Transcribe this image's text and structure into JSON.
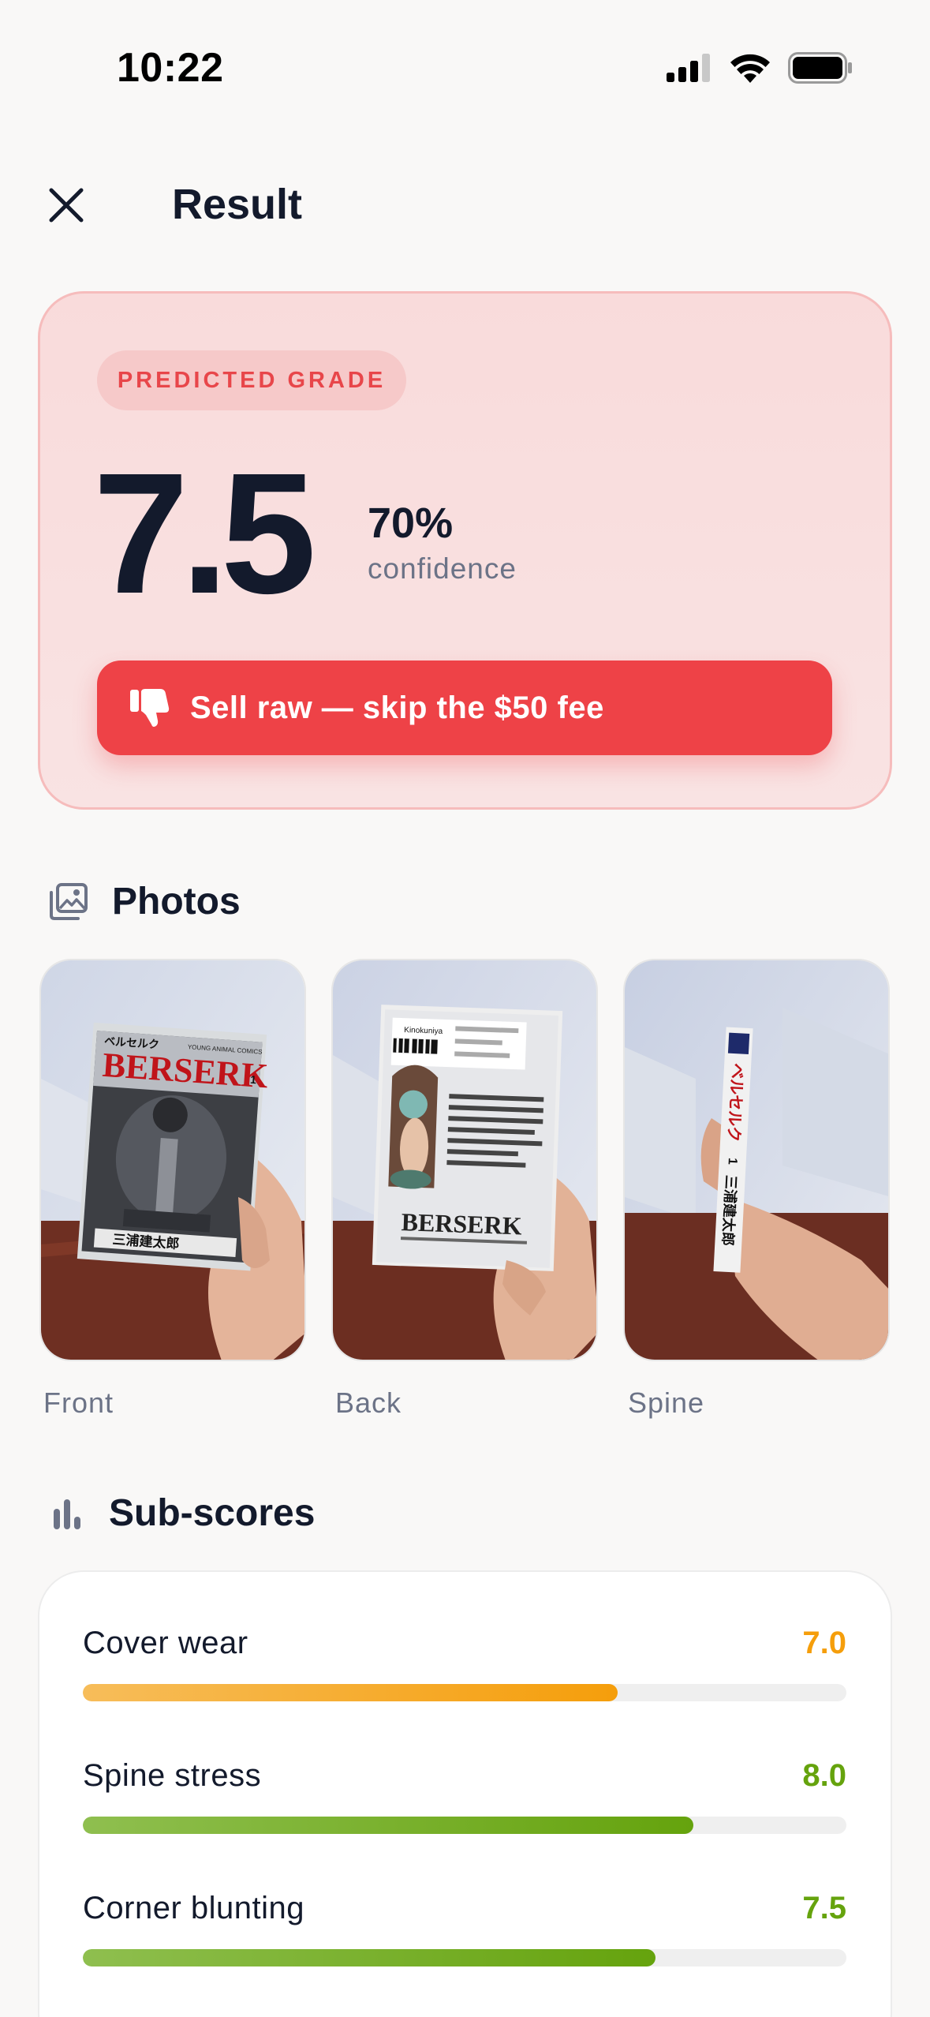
{
  "status_bar": {
    "time": "10:22"
  },
  "header": {
    "title": "Result"
  },
  "grade": {
    "badge": "PREDICTED GRADE",
    "value": "7.5",
    "confidence": "70%",
    "confidence_label": "confidence",
    "action_label": "Sell raw — skip the $50 fee"
  },
  "photos": {
    "title": "Photos",
    "items": [
      {
        "label": "Front"
      },
      {
        "label": "Back"
      },
      {
        "label": "Spine"
      }
    ],
    "cover_text": {
      "kana": "ベルセルク",
      "series": "YOUNG ANIMAL COMICS",
      "title": "BERSERK",
      "volume": "1",
      "author": "三浦建太郎",
      "store": "Kinokuniya"
    }
  },
  "subscores": {
    "title": "Sub-scores",
    "items": [
      {
        "name": "Cover wear",
        "value": "7.0",
        "fraction": 0.7,
        "color": "#f59e0b"
      },
      {
        "name": "Spine stress",
        "value": "8.0",
        "fraction": 0.8,
        "color": "#65a30d"
      },
      {
        "name": "Corner blunting",
        "value": "7.5",
        "fraction": 0.75,
        "color": "#65a30d"
      }
    ]
  },
  "colors": {
    "accent": "#ee4247",
    "warning": "#f59e0b",
    "success": "#65a30d"
  },
  "icons": {
    "close": "close-icon",
    "thumbs_down": "thumbs-down-icon",
    "photos": "image-gallery-icon",
    "subscores": "bar-chart-icon"
  }
}
